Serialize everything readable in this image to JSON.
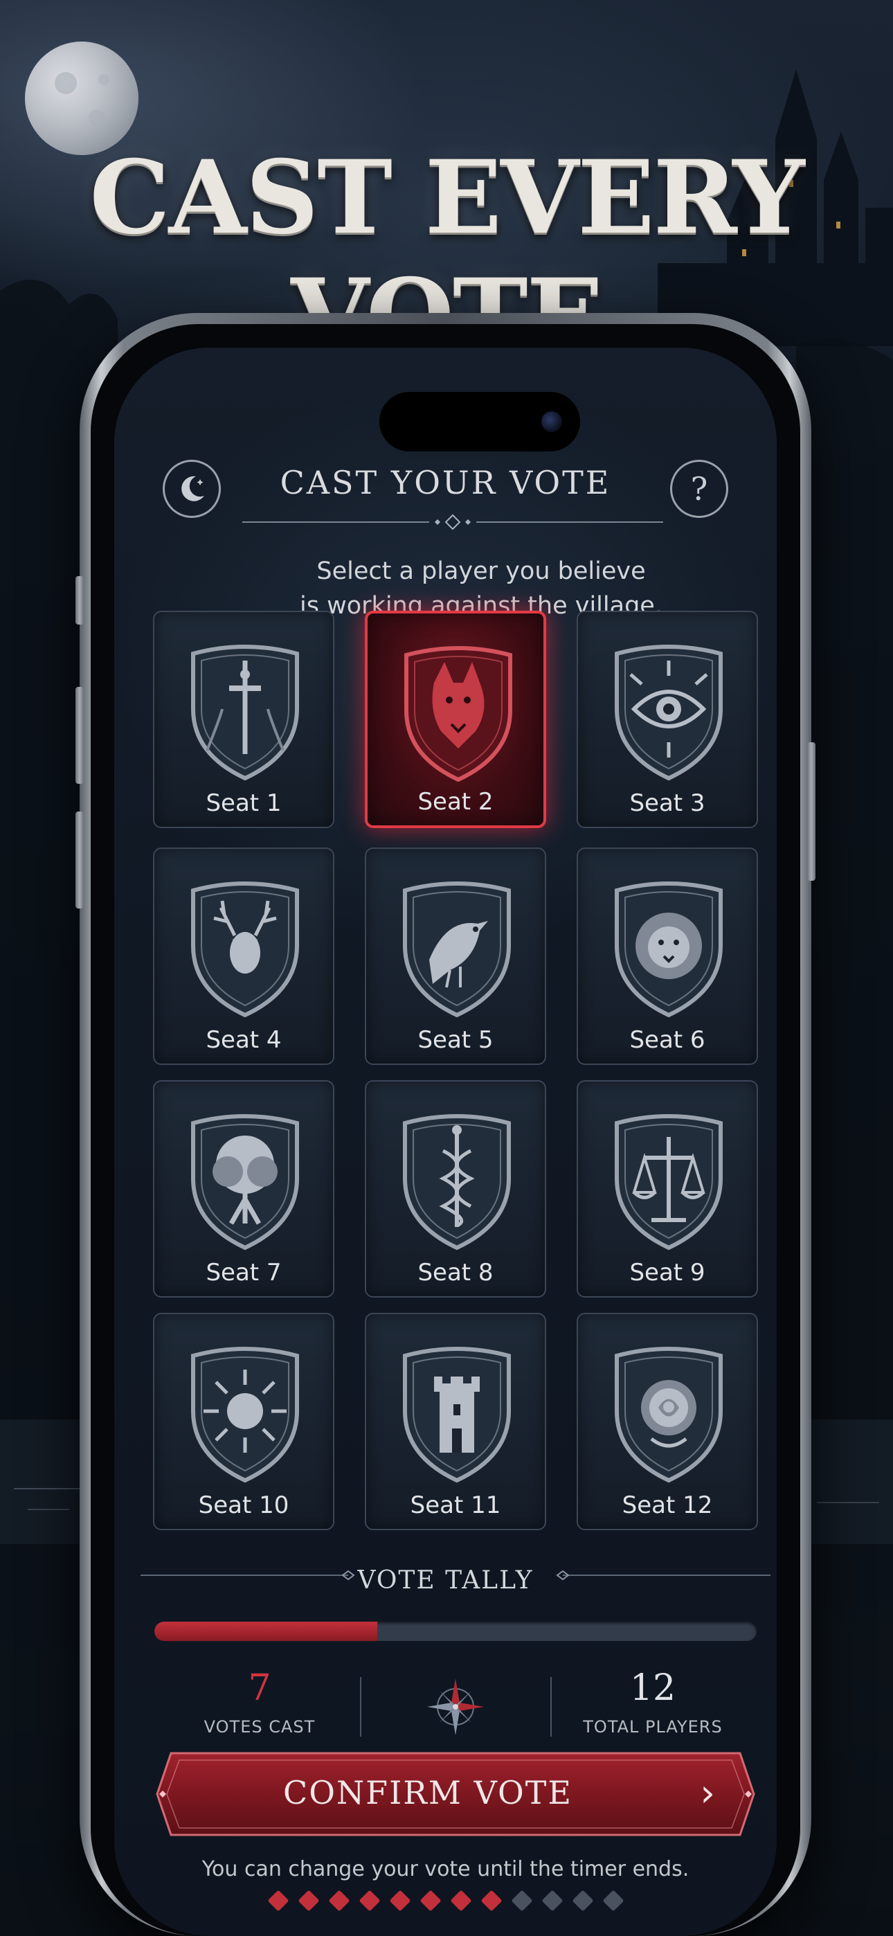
{
  "hero": {
    "title": "CAST EVERY VOTE"
  },
  "header": {
    "title": "CAST YOUR VOTE",
    "left_icon": "crescent-moon-icon",
    "right_icon": "help-icon",
    "help_glyph": "?"
  },
  "instruction": {
    "line1": "Select a player you believe",
    "line2": "is working against the village."
  },
  "seats": [
    {
      "label": "Seat 1",
      "emblem": "sword",
      "selected": false
    },
    {
      "label": "Seat 2",
      "emblem": "wolf",
      "selected": true
    },
    {
      "label": "Seat 3",
      "emblem": "eye",
      "selected": false
    },
    {
      "label": "Seat 4",
      "emblem": "stag",
      "selected": false
    },
    {
      "label": "Seat 5",
      "emblem": "raven",
      "selected": false
    },
    {
      "label": "Seat 6",
      "emblem": "lion",
      "selected": false
    },
    {
      "label": "Seat 7",
      "emblem": "tree",
      "selected": false
    },
    {
      "label": "Seat 8",
      "emblem": "caduceus",
      "selected": false
    },
    {
      "label": "Seat 9",
      "emblem": "scales",
      "selected": false
    },
    {
      "label": "Seat 10",
      "emblem": "sun",
      "selected": false
    },
    {
      "label": "Seat 11",
      "emblem": "tower",
      "selected": false
    },
    {
      "label": "Seat 12",
      "emblem": "rose",
      "selected": false
    }
  ],
  "tally": {
    "title": "VOTE TALLY",
    "votes_cast": "7",
    "votes_cast_label": "VOTES CAST",
    "total_players": "12",
    "total_players_label": "TOTAL PLAYERS",
    "progress": 0.37
  },
  "confirm": {
    "label": "CONFIRM VOTE",
    "chevron": "›"
  },
  "footnote": "You can change your vote until the timer ends.",
  "page_indicator": {
    "total": 12,
    "active": 8
  },
  "colors": {
    "accent_red": "#c2303b",
    "selected_border": "#e23a45",
    "text_light": "#e2e4e7",
    "inactive_dot": "#4a5260"
  }
}
